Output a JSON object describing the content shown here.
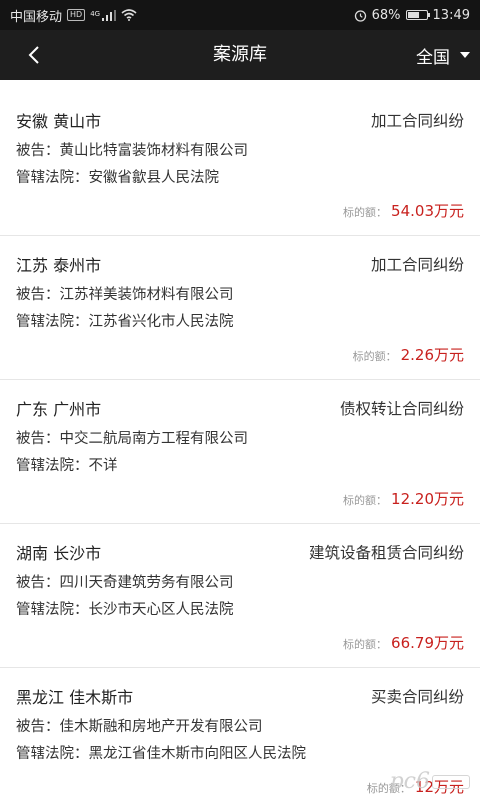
{
  "status_bar": {
    "carrier": "中国移动",
    "hd": "HD",
    "network": "4G",
    "battery_percent": "68%",
    "battery_level": 0.68,
    "time": "13:49"
  },
  "nav": {
    "back_icon": "chevron-left-icon",
    "title": "案源库",
    "region": "全国"
  },
  "labels": {
    "defendant": "被告：",
    "court": "管辖法院：",
    "amount": "标的额："
  },
  "cases": [
    {
      "location": "安徽 黄山市",
      "type": "加工合同纠纷",
      "defendant": "黄山比特富装饰材料有限公司",
      "court": "安徽省歙县人民法院",
      "amount": "54.03万元"
    },
    {
      "location": "江苏 泰州市",
      "type": "加工合同纠纷",
      "defendant": "江苏祥美装饰材料有限公司",
      "court": "江苏省兴化市人民法院",
      "amount": "2.26万元"
    },
    {
      "location": "广东 广州市",
      "type": "债权转让合同纠纷",
      "defendant": "中交二航局南方工程有限公司",
      "court": "不详",
      "amount": "12.20万元"
    },
    {
      "location": "湖南 长沙市",
      "type": "建筑设备租赁合同纠纷",
      "defendant": "四川天奇建筑劳务有限公司",
      "court": "长沙市天心区人民法院",
      "amount": "66.79万元"
    },
    {
      "location": "黑龙江 佳木斯市",
      "type": "买卖合同纠纷",
      "defendant": "佳木斯融和房地产开发有限公司",
      "court": "黑龙江省佳木斯市向阳区人民法院",
      "amount": "12万元"
    }
  ],
  "watermark": "pc6"
}
